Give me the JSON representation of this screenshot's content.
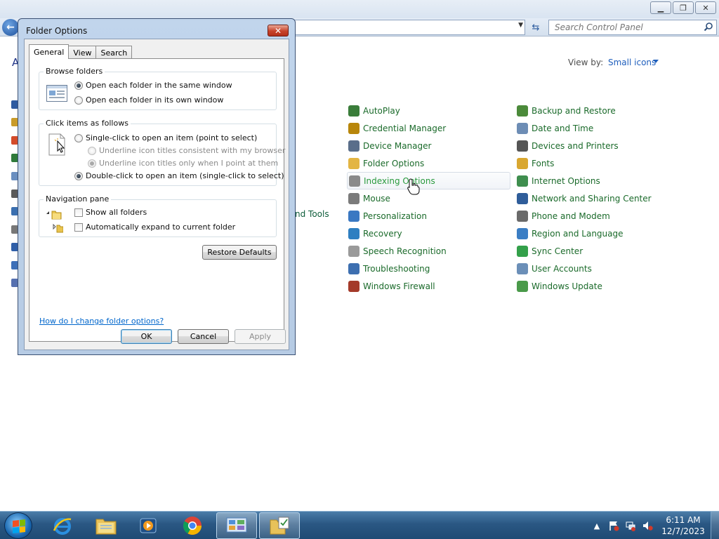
{
  "window": {
    "minimize": "▁",
    "maximize": "❐",
    "close": "✕",
    "back": "←",
    "refresh": "⇆",
    "search_placeholder": "Search Control Panel",
    "heading_fragment": "A",
    "view_by_label": "View by:",
    "view_by_value": "Small icons",
    "partial_text": "nd Tools"
  },
  "control_panel": {
    "column1": [
      {
        "label": "AutoPlay",
        "color": "#3a7d3a"
      },
      {
        "label": "Credential Manager",
        "color": "#b8860b"
      },
      {
        "label": "Device Manager",
        "color": "#5a6e8a"
      },
      {
        "label": "Folder Options",
        "color": "#e3b543"
      },
      {
        "label": "Indexing Options",
        "color": "#8a8a8a"
      },
      {
        "label": "Mouse",
        "color": "#7b7b7b"
      },
      {
        "label": "Personalization",
        "color": "#3a78c2"
      },
      {
        "label": "Recovery",
        "color": "#2e7fc1"
      },
      {
        "label": "Speech Recognition",
        "color": "#9a9a9a"
      },
      {
        "label": "Troubleshooting",
        "color": "#3d6fb0"
      },
      {
        "label": "Windows Firewall",
        "color": "#a43a2a"
      }
    ],
    "column2": [
      {
        "label": "Backup and Restore",
        "color": "#4b8a3a"
      },
      {
        "label": "Date and Time",
        "color": "#6d8db5"
      },
      {
        "label": "Devices and Printers",
        "color": "#555555"
      },
      {
        "label": "Fonts",
        "color": "#d9a730"
      },
      {
        "label": "Internet Options",
        "color": "#3f8e4e"
      },
      {
        "label": "Network and Sharing Center",
        "color": "#2f5d9a"
      },
      {
        "label": "Phone and Modem",
        "color": "#6a6a6a"
      },
      {
        "label": "Region and Language",
        "color": "#3b7ec4"
      },
      {
        "label": "Sync Center",
        "color": "#33a04a"
      },
      {
        "label": "User Accounts",
        "color": "#6b8fb8"
      },
      {
        "label": "Windows Update",
        "color": "#4a9a4a"
      }
    ],
    "left_icon_colors": [
      "#2d5aa0",
      "#c99b2a",
      "#d34b2a",
      "#2f7a3a",
      "#6a8fc0",
      "#5a5a5a",
      "#3a6fb0",
      "#777777",
      "#2f5fa8",
      "#3c6fb8",
      "#5570b0"
    ]
  },
  "dialog": {
    "title": "Folder Options",
    "close": "✕",
    "tabs": [
      "General",
      "View",
      "Search"
    ],
    "browse": {
      "title": "Browse folders",
      "option1": "Open each folder in the same window",
      "option2": "Open each folder in its own window"
    },
    "click": {
      "title": "Click items as follows",
      "single": "Single-click to open an item (point to select)",
      "underline1": "Underline icon titles consistent with my browser",
      "underline2": "Underline icon titles only when I point at them",
      "double": "Double-click to open an item (single-click to select)"
    },
    "nav": {
      "title": "Navigation pane",
      "show_all": "Show all folders",
      "auto_expand": "Automatically expand to current folder"
    },
    "restore": "Restore Defaults",
    "help_link": "How do I change folder options?",
    "ok": "OK",
    "cancel": "Cancel",
    "apply": "Apply"
  },
  "taskbar": {
    "time": "6:11 AM",
    "date": "12/7/2023",
    "tray_arrow": "▲"
  }
}
